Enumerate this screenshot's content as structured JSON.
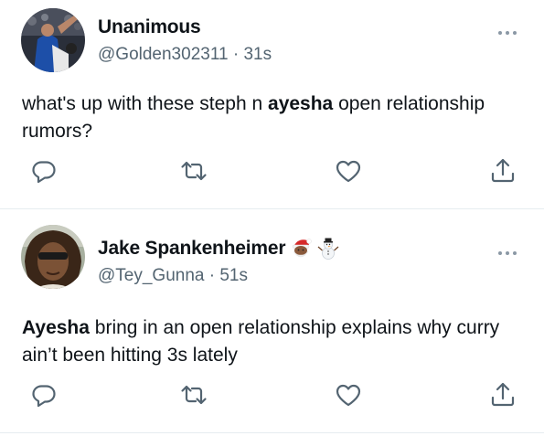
{
  "tweets": [
    {
      "display_name": "Unanimous",
      "handle": "@Golden302311",
      "separator": "·",
      "time": "31s",
      "text_before": "what's up with these steph n ",
      "text_bold": "ayesha",
      "text_after": " open relationship rumors?",
      "emojis": [],
      "actions": [
        "reply-icon",
        "retweet-icon",
        "like-icon",
        "share-icon"
      ]
    },
    {
      "display_name": "Jake Spankenheimer",
      "handle": "@Tey_Gunna",
      "separator": "·",
      "time": "51s",
      "text_before": "",
      "text_bold": "Ayesha",
      "text_after": " bring in an open relationship explains why curry ain’t been hitting 3s lately",
      "emojis": [
        "santa-emoji",
        "snowman-emoji"
      ],
      "actions": [
        "reply-icon",
        "retweet-icon",
        "like-icon",
        "share-icon"
      ]
    }
  ],
  "colors": {
    "text": "#0f1419",
    "secondary": "#536471",
    "divider": "#e6ecf0",
    "icon": "#536471"
  }
}
